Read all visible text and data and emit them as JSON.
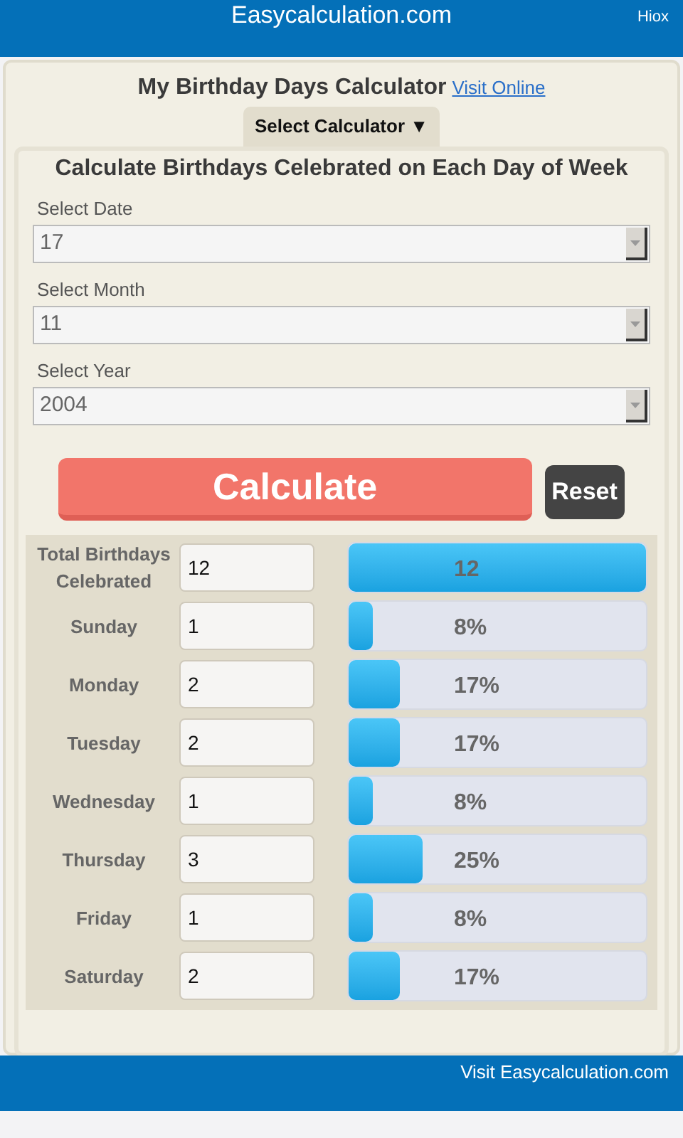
{
  "header": {
    "title": "Easycalculation.com",
    "link": "Hiox"
  },
  "calculator": {
    "title": "My Birthday Days Calculator",
    "visit_link": "Visit Online",
    "menu_button": "Select Calculator ▼"
  },
  "form": {
    "heading": "Calculate Birthdays Celebrated on Each Day of Week",
    "fields": [
      {
        "label": "Select Date",
        "value": "17"
      },
      {
        "label": "Select Month",
        "value": "11"
      },
      {
        "label": "Select Year",
        "value": "2004"
      }
    ],
    "calculate_button": "Calculate",
    "reset_button": "Reset"
  },
  "results": [
    {
      "label": "Total Birthdays Celebrated",
      "value": "12",
      "level": 1,
      "reading": "12"
    },
    {
      "label": "Sunday",
      "value": "1",
      "level": 0.08,
      "reading": "8%"
    },
    {
      "label": "Monday",
      "value": "2",
      "level": 0.17,
      "reading": "17%"
    },
    {
      "label": "Tuesday",
      "value": "2",
      "level": 0.17,
      "reading": "17%"
    },
    {
      "label": "Wednesday",
      "value": "1",
      "level": 0.08,
      "reading": "8%"
    },
    {
      "label": "Thursday",
      "value": "3",
      "level": 0.25,
      "reading": "25%"
    },
    {
      "label": "Friday",
      "value": "1",
      "level": 0.08,
      "reading": "8%"
    },
    {
      "label": "Saturday",
      "value": "2",
      "level": 0.17,
      "reading": "17%"
    }
  ],
  "footer": {
    "link": "Visit Easycalculation.com"
  }
}
